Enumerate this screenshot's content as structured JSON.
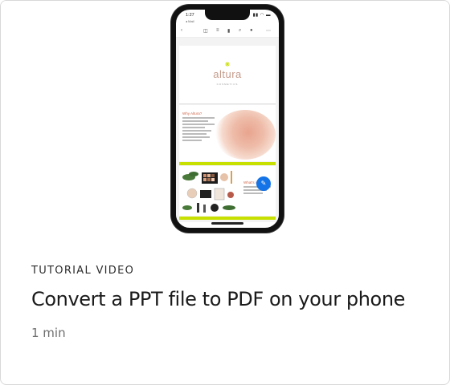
{
  "card": {
    "label": "TUTORIAL VIDEO",
    "title": "Convert a PPT file to PDF on your phone",
    "duration": "1 min"
  },
  "phone": {
    "status_time": "1:27",
    "status_back": "◂ Mail",
    "logo_text": "altura",
    "logo_sub": "COSMETICS",
    "slide2_title": "Why Altura?",
    "slide3_title": "What's inside?"
  },
  "colors": {
    "accent_bar": "#c8e000",
    "fab": "#1473e6",
    "brand_text": "#c49a8a",
    "headline": "#d0674a"
  }
}
